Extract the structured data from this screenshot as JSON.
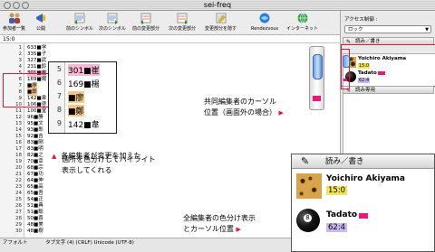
{
  "window": {
    "title": "sei-freq"
  },
  "toolbar": {
    "items": [
      {
        "label": "参加者一覧",
        "icon": "people-icon"
      },
      {
        "label": "公開",
        "icon": "megaphone-icon"
      },
      {
        "label": "前のシンボル",
        "icon": "prev-symbol-icon"
      },
      {
        "label": "次のシンボル",
        "icon": "next-symbol-icon"
      },
      {
        "label": "前の変更部分",
        "icon": "prev-change-icon"
      },
      {
        "label": "次の変更部分",
        "icon": "next-change-icon"
      },
      {
        "label": "変更部分を隠す",
        "icon": "hide-changes-icon"
      },
      {
        "label": "Rendezvous",
        "icon": "rendezvous-icon"
      },
      {
        "label": "インターネット",
        "icon": "internet-icon"
      }
    ]
  },
  "pathbar": {
    "text": "15:0"
  },
  "editor": {
    "lines": [
      {
        "num": "1",
        "text": "633■学"
      },
      {
        "num": "2",
        "text": "335■子"
      },
      {
        "num": "3",
        "text": "327■武"
      },
      {
        "num": "4",
        "text": "231■鈴"
      },
      {
        "num": "5",
        "text": "301■崔"
      },
      {
        "num": "6",
        "text": "169■楊"
      },
      {
        "num": "7",
        "text": "■廖"
      },
      {
        "num": "8",
        "text": "■鄭"
      },
      {
        "num": "9",
        "text": "142■韋"
      },
      {
        "num": "10",
        "text": "106■啓"
      },
      {
        "num": "11",
        "text": "100■堂"
      },
      {
        "num": "12",
        "text": "96■勝"
      },
      {
        "num": "13",
        "text": "95■文"
      },
      {
        "num": "14",
        "text": "93■郎"
      },
      {
        "num": "15",
        "text": "92■吉"
      },
      {
        "num": "16",
        "text": "83■剛"
      },
      {
        "num": "17",
        "text": "83■明"
      },
      {
        "num": "18",
        "text": "82■之"
      },
      {
        "num": "19",
        "text": "70■幸"
      },
      {
        "num": "20",
        "text": "68■宗"
      },
      {
        "num": "21",
        "text": "67■功"
      },
      {
        "num": "22",
        "text": "64■伸"
      },
      {
        "num": "23",
        "text": "65■高"
      },
      {
        "num": "24",
        "text": "65■吾"
      },
      {
        "num": "25",
        "text": "54■正"
      },
      {
        "num": "26",
        "text": "51■典"
      },
      {
        "num": "27",
        "text": "51■聡"
      },
      {
        "num": "28",
        "text": "50■喜"
      },
      {
        "num": "29",
        "text": "48■美"
      },
      {
        "num": "30",
        "text": "48■樹"
      }
    ],
    "zoom_lines": [
      {
        "num": "5",
        "text": "301■崔"
      },
      {
        "num": "6",
        "text": "169■楊"
      },
      {
        "num": "7",
        "text": "■廖"
      },
      {
        "num": "8",
        "text": "■鄭"
      },
      {
        "num": "9",
        "text": "142■韋"
      }
    ]
  },
  "status": {
    "left": "アフォルト",
    "text": "タブ文字 (4) (CRLF) Unicode (UTF-8)"
  },
  "right_panel": {
    "access_label": "アクセス制御 :",
    "access_value": "ロック",
    "rw_header": "読み／書き",
    "ro_header": "読み専用",
    "users": [
      {
        "name": "Yoichiro Akiyama",
        "pos": "15:0",
        "color": "#f6b8d4",
        "avatar": "leopard-avatar"
      },
      {
        "name": "Tadato",
        "pos": "62:4",
        "color": "#e8187a",
        "avatar": "eightball-avatar"
      }
    ]
  },
  "annotations": {
    "highlight_note": [
      "各編集者が変更を加えた",
      "個所を色分けしてハイライト",
      "表示してくれる"
    ],
    "cursor_note": [
      "共同編集者のカーソル",
      "位置（画面外の場合）"
    ],
    "color_note": [
      "全編集者の色分け表示",
      "とカーソル位置"
    ]
  },
  "big_panel": {
    "header": "読み／書き",
    "users": [
      {
        "name": "Yoichiro Akiyama",
        "pos": "15:0",
        "color": "#f6b8d4"
      },
      {
        "name": "Tadato",
        "pos": "62:4",
        "color": "#e8187a"
      }
    ]
  },
  "colors": {
    "highlight_pink": "#f6b8d4",
    "highlight_orange": "#f5c58d",
    "annotation_red": "#e0163a"
  }
}
